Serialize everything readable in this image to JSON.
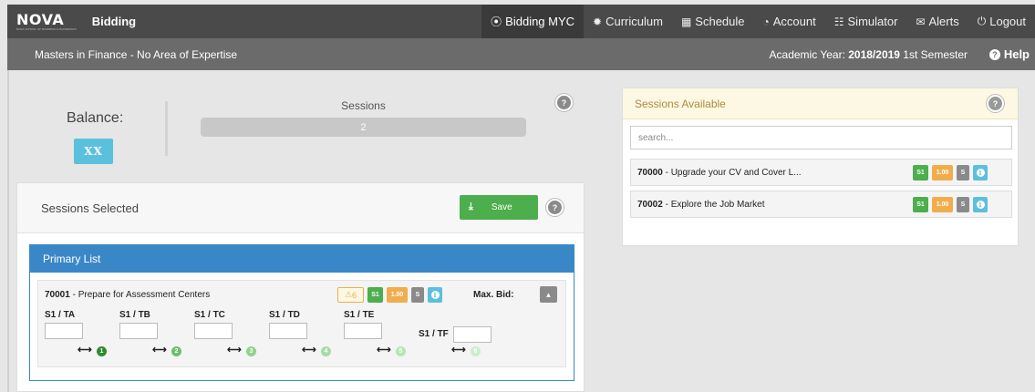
{
  "brand": {
    "logo": "NOVA",
    "logo_sub": "NOVA SCHOOL OF BUSINESS & ECONOMICS",
    "app": "Bidding"
  },
  "nav": [
    {
      "label": "Bidding MYC",
      "icon": "target-icon",
      "glyph": "⦿"
    },
    {
      "label": "Curriculum",
      "icon": "cog-icon",
      "glyph": "✹"
    },
    {
      "label": "Schedule",
      "icon": "calendar-icon",
      "glyph": "▦"
    },
    {
      "label": "Account",
      "icon": "dashboard-icon",
      "glyph": "◔"
    },
    {
      "label": "Simulator",
      "icon": "list-icon",
      "glyph": "☷"
    },
    {
      "label": "Alerts",
      "icon": "envelope-icon",
      "glyph": "✉"
    },
    {
      "label": "Logout",
      "icon": "power-icon",
      "glyph": "⏻"
    }
  ],
  "subbar": {
    "program": "Masters in Finance - No Area of Expertise",
    "year_prefix": "Academic Year: ",
    "year": "2018/2019",
    "semester": " 1st Semester",
    "help": "Help"
  },
  "balance": {
    "label": "Balance:",
    "value": "XX"
  },
  "sessions": {
    "label": "Sessions",
    "count": "2"
  },
  "selected": {
    "title": "Sessions Selected",
    "save": "Save",
    "primary_list": "Primary List",
    "item": {
      "code": "70001",
      "name": " - Prepare for Assessment Centers",
      "warning_count": "6",
      "semester": "S1",
      "credits": "1.00",
      "type": "S",
      "info": "i",
      "max_bid": "Max. Bid:",
      "slots": [
        "S1 / TA",
        "S1 / TB",
        "S1 / TC",
        "S1 / TD",
        "S1 / TE",
        "S1 / TF"
      ],
      "orders": [
        "1",
        "2",
        "3",
        "4",
        "5",
        "6"
      ]
    }
  },
  "available": {
    "title": "Sessions Available",
    "search_placeholder": "search...",
    "rows": [
      {
        "code": "70000",
        "name": " - Upgrade your CV and Cover L...",
        "semester": "S1",
        "credits": "1.00",
        "type": "S",
        "info": "i"
      },
      {
        "code": "70002",
        "name": " - Explore the Job Market",
        "semester": "S1",
        "credits": "1.00",
        "type": "S",
        "info": "i"
      }
    ]
  },
  "colors": {
    "navbar": "#4a4a4a",
    "subbar": "#6b6b6b",
    "primary": "#3a87c8",
    "green": "#4cae4c",
    "orange": "#f0ad4e",
    "info": "#5bc0de"
  }
}
